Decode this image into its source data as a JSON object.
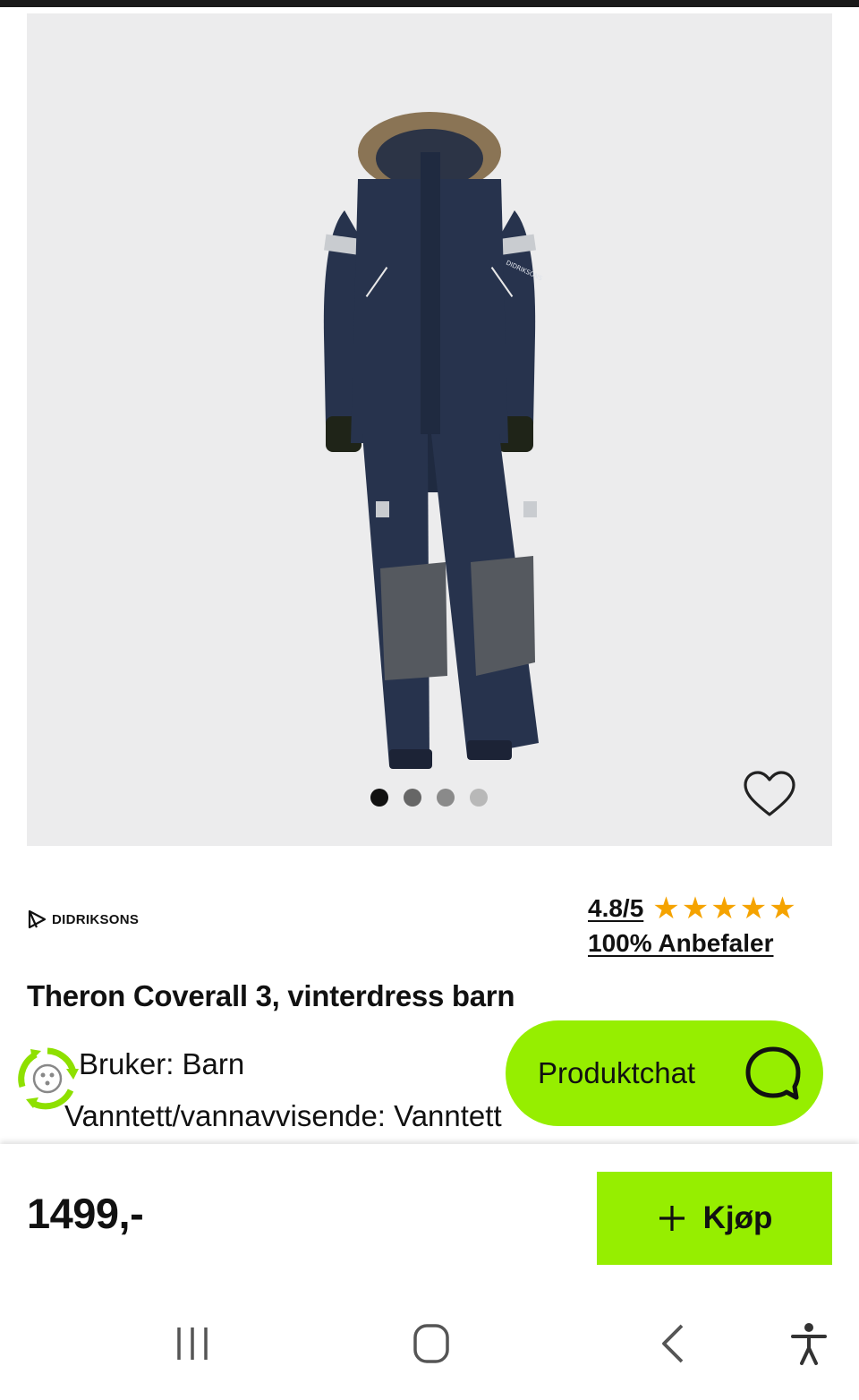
{
  "product": {
    "brand": "DIDRIKSONS",
    "title": "Theron Coverall 3, vinterdress barn",
    "image_count": 4,
    "active_image_index": 0,
    "favorite_icon": "heart-outline-icon"
  },
  "rating": {
    "score": "4.8/5",
    "stars": [
      "★",
      "★",
      "★",
      "★",
      "★"
    ],
    "recommend": "100% Anbefaler"
  },
  "attributes": [
    "Bruker: Barn",
    "Vanntett/vannavvisende: Vanntett"
  ],
  "chat": {
    "label": "Produktchat",
    "icon": "chat-bubble-icon"
  },
  "purchase": {
    "price": "1499,-",
    "buy_label": "Kjøp",
    "buy_icon": "plus-icon"
  },
  "navigation": {
    "recent_apps_icon": "recent-apps-icon",
    "home_icon": "home-icon",
    "back_icon": "back-icon",
    "accessibility_icon": "accessibility-icon"
  },
  "colors": {
    "accent": "#96ee00",
    "star": "#f5a300",
    "gallery_bg": "#ececed",
    "dot_active": "#111111",
    "dot_inactive": "#666666"
  }
}
